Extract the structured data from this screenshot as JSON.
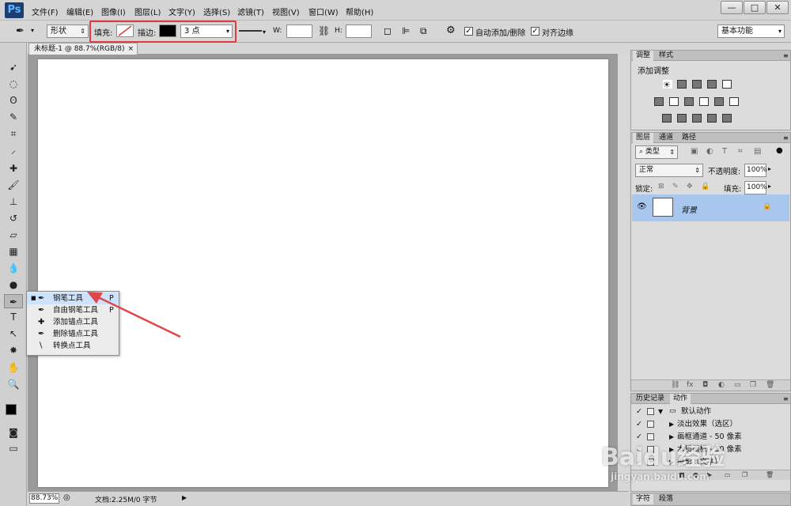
{
  "app": {
    "logo": "Ps"
  },
  "menu": [
    "文件(F)",
    "编辑(E)",
    "图像(I)",
    "图层(L)",
    "文字(Y)",
    "选择(S)",
    "滤镜(T)",
    "视图(V)",
    "窗口(W)",
    "帮助(H)"
  ],
  "window_controls": {
    "minimize": "—",
    "maximize": "□",
    "close": "✕"
  },
  "options": {
    "mode": "形状",
    "fill_label": "填充:",
    "stroke_label": "描边:",
    "stroke_size": "3 点",
    "w_label": "W:",
    "h_label": "H:",
    "auto_add_delete": "自动添加/删除",
    "align_edges": "对齐边缘",
    "workspace": "基本功能",
    "auto_add_checked": "✓",
    "align_checked": "✓"
  },
  "document": {
    "tab_title": "未标题-1 @ 88.7%(RGB/8)",
    "tab_close": "×",
    "zoom": "88.73%",
    "doc_info": "文档:2.25M/0 字节"
  },
  "flyout": {
    "items": [
      {
        "label": "钢笔工具",
        "key": "P",
        "active": true
      },
      {
        "label": "自由钢笔工具",
        "key": "P"
      },
      {
        "label": "添加锚点工具",
        "key": ""
      },
      {
        "label": "删除锚点工具",
        "key": ""
      },
      {
        "label": "转换点工具",
        "key": ""
      }
    ]
  },
  "adjust_panel": {
    "tabs": [
      "调整",
      "样式"
    ],
    "title": "添加调整"
  },
  "layers_panel": {
    "tabs": [
      "图层",
      "通道",
      "路径"
    ],
    "filter": "类型",
    "blend_mode": "正常",
    "opacity_label": "不透明度:",
    "opacity": "100%",
    "lock_label": "锁定:",
    "fill_label": "填充:",
    "fill": "100%",
    "layer_name": "背景",
    "eye": "👁",
    "lock_icon": "🔒"
  },
  "actions_panel": {
    "tabs": [
      "历史记录",
      "动作"
    ],
    "rows": [
      "默认动作",
      "淡出效果（选区）",
      "画框通道 - 50 像素",
      "木质画框 - 50 像素",
      "投影（文字）"
    ],
    "check": "✓",
    "footer_tabs": [
      "字符",
      "段落"
    ]
  },
  "watermark": {
    "brand": "Baidu经验",
    "url": "jingyan.baidu.com"
  },
  "colors": {
    "highlight": "#e0393e",
    "arrow": "#e0474b",
    "layer_select": "#a9c6ee"
  }
}
